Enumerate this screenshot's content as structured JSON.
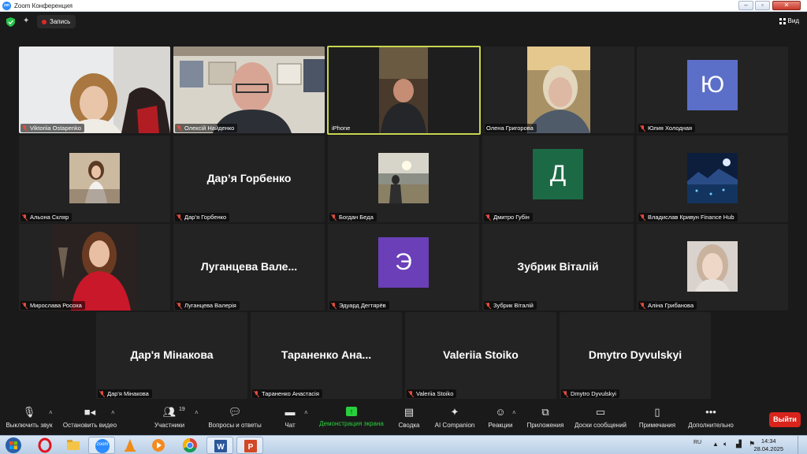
{
  "window": {
    "title": "Zoom Конференция",
    "app_icon_text": "zm"
  },
  "topbar": {
    "recording_label": "Запись",
    "view_label": "Вид"
  },
  "participants": [
    {
      "name": "Viktoriia Ostapenko",
      "muted": true
    },
    {
      "name": "Олексій Найденко",
      "muted": true
    },
    {
      "name": "iPhone",
      "muted": false,
      "active_speaker": true
    },
    {
      "name": "Олена Григорова",
      "muted": false
    },
    {
      "name": "Юлия Холодная",
      "muted": true,
      "avatar_letter": "Ю",
      "avatar_color": "#5b6fc9"
    },
    {
      "name": "Альона Скляр",
      "muted": true
    },
    {
      "name": "Дар’я Горбенко",
      "muted": true,
      "display_name": "Дар’я Горбенко"
    },
    {
      "name": "Богдан Беда",
      "muted": true
    },
    {
      "name": "Дмитро Губін",
      "muted": true,
      "avatar_letter": "Д",
      "avatar_color": "#1c6a45"
    },
    {
      "name": "Владислав Кривун Finance Hub",
      "muted": true
    },
    {
      "name": "Мирослава Росоха",
      "muted": true
    },
    {
      "name": "Луганцева Валерія",
      "muted": true,
      "display_name": "Луганцева  Вале..."
    },
    {
      "name": "Эдуард Дегтярёв",
      "muted": true,
      "avatar_letter": "Э",
      "avatar_color": "#6b3fb8"
    },
    {
      "name": "Зубрик Віталій",
      "muted": true,
      "display_name": "Зубрик Віталій"
    },
    {
      "name": "Аліна Грибанова",
      "muted": true
    },
    {
      "name": "Дар'я Мінакова",
      "muted": true,
      "display_name": "Дар'я Мінакова"
    },
    {
      "name": "Тараненко Анастасія",
      "muted": true,
      "display_name": "Тараненко  Ана..."
    },
    {
      "name": "Valeriia Stoiko",
      "muted": true,
      "display_name": "Valeriia Stoiko"
    },
    {
      "name": "Dmytro Dyvulskyi",
      "muted": true,
      "display_name": "Dmytro Dyvulskyi"
    }
  ],
  "toolbar": {
    "mute": "Выключить звук",
    "video": "Остановить видео",
    "participants": "Участники",
    "participants_count": "19",
    "qa": "Вопросы и ответы",
    "chat": "Чат",
    "share": "Демонстрация экрана",
    "summary": "Сводка",
    "ai_companion": "AI Companion",
    "reactions": "Реакции",
    "apps": "Приложения",
    "whiteboards": "Доски сообщений",
    "notes": "Примечания",
    "more": "Дополнительно",
    "leave": "Выйти",
    "share_color": "#27d13b",
    "leave_color": "#d9241c"
  },
  "taskbar": {
    "zoom_label": "zoom",
    "language": "RU",
    "time": "14:34",
    "date": "28.04.2025"
  }
}
